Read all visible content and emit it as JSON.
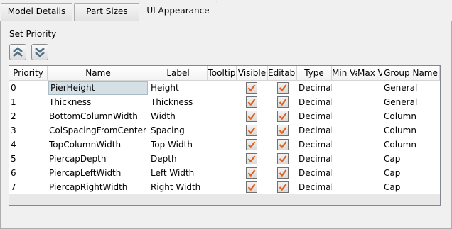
{
  "tabs": [
    {
      "label": "Model Details",
      "active": false
    },
    {
      "label": "Part Sizes",
      "active": false
    },
    {
      "label": "UI Appearance",
      "active": true
    }
  ],
  "set_priority_label": "Set Priority",
  "priority_buttons": [
    {
      "name": "move-up-button",
      "icon": "double-chevron-up-icon"
    },
    {
      "name": "move-down-button",
      "icon": "double-chevron-down-icon"
    }
  ],
  "columns": [
    "Priority",
    "Name",
    "Label",
    "Tooltip",
    "Visible",
    "Editable",
    "Type",
    "Min Value",
    "Max Value",
    "Group Name"
  ],
  "rows": [
    {
      "priority": "0",
      "name": "PierHeight",
      "label": "Height",
      "tooltip": "",
      "visible": true,
      "editable": true,
      "type": "Decimal",
      "min": "",
      "max": "",
      "group": "General"
    },
    {
      "priority": "1",
      "name": "Thickness",
      "label": "Thickness",
      "tooltip": "",
      "visible": true,
      "editable": true,
      "type": "Decimal",
      "min": "",
      "max": "",
      "group": "General"
    },
    {
      "priority": "2",
      "name": "BottomColumnWidth",
      "label": "Width",
      "tooltip": "",
      "visible": true,
      "editable": true,
      "type": "Decimal",
      "min": "",
      "max": "",
      "group": "Column"
    },
    {
      "priority": "3",
      "name": "ColSpacingFromCenter",
      "label": "Spacing",
      "tooltip": "",
      "visible": true,
      "editable": true,
      "type": "Decimal",
      "min": "",
      "max": "",
      "group": "Column"
    },
    {
      "priority": "4",
      "name": "TopColumnWidth",
      "label": "Top Width",
      "tooltip": "",
      "visible": true,
      "editable": true,
      "type": "Decimal",
      "min": "",
      "max": "",
      "group": "Column"
    },
    {
      "priority": "5",
      "name": "PiercapDepth",
      "label": "Depth",
      "tooltip": "",
      "visible": true,
      "editable": true,
      "type": "Decimal",
      "min": "",
      "max": "",
      "group": "Cap"
    },
    {
      "priority": "6",
      "name": "PiercapLeftWidth",
      "label": "Left Width",
      "tooltip": "",
      "visible": true,
      "editable": true,
      "type": "Decimal",
      "min": "",
      "max": "",
      "group": "Cap"
    },
    {
      "priority": "7",
      "name": "PiercapRightWidth",
      "label": "Right Width",
      "tooltip": "",
      "visible": true,
      "editable": true,
      "type": "Decimal",
      "min": "",
      "max": "",
      "group": "Cap"
    }
  ],
  "selected_cell": {
    "row": 0,
    "column": "Name"
  },
  "colors": {
    "check": "#e0601a",
    "selection": "#d4e0e6",
    "chevron": "#4f6f86"
  }
}
